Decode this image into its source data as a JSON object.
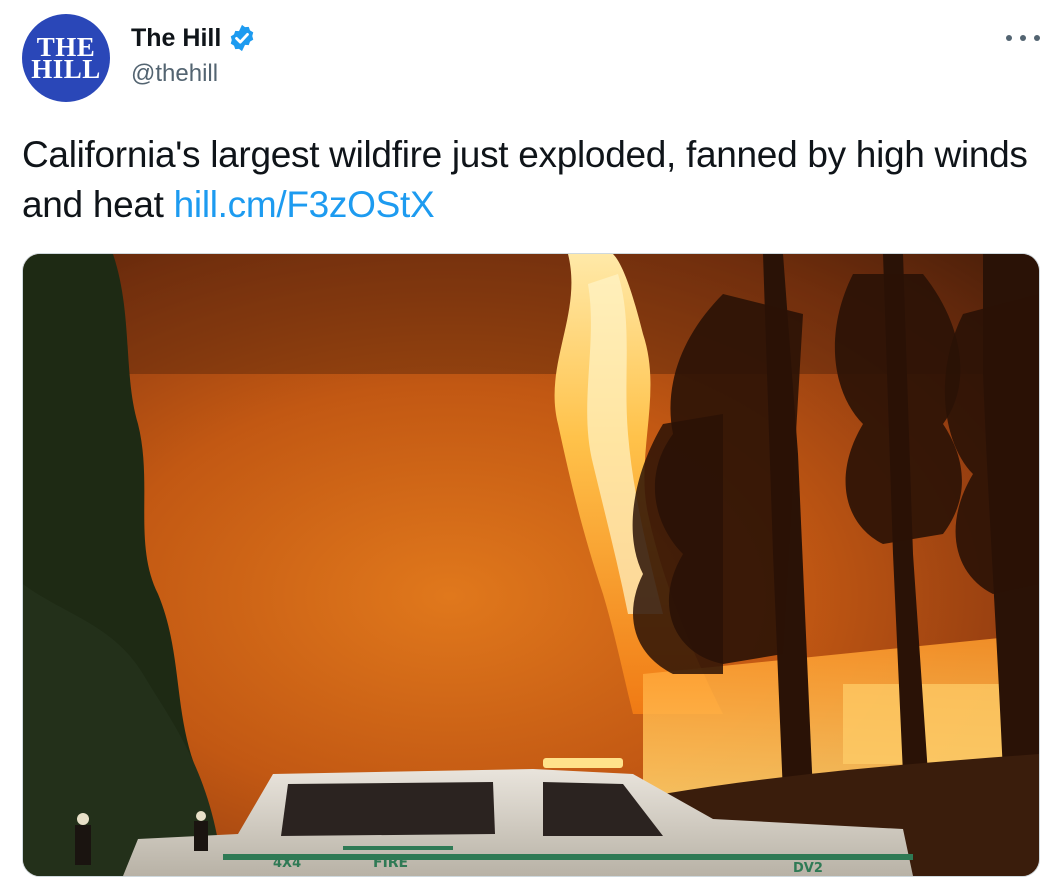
{
  "author": {
    "avatar_text_line1": "THE",
    "avatar_text_line2": "HILL",
    "display_name": "The Hill",
    "handle": "@thehill",
    "verified": true
  },
  "tweet": {
    "text": "California's largest wildfire just exploded, fanned by high winds and heat",
    "link": "hill.cm/F3zOStX"
  },
  "media": {
    "vehicle_labels": {
      "badge": "4X4",
      "side": "FIRE",
      "unit": "DV2"
    }
  },
  "icons": {
    "verified": "verified-badge-icon",
    "more": "more-options-icon"
  },
  "colors": {
    "link": "#1d9bf0",
    "verified": "#1d9bf0",
    "avatar_bg": "#2a47b8",
    "secondary_text": "#536471"
  }
}
